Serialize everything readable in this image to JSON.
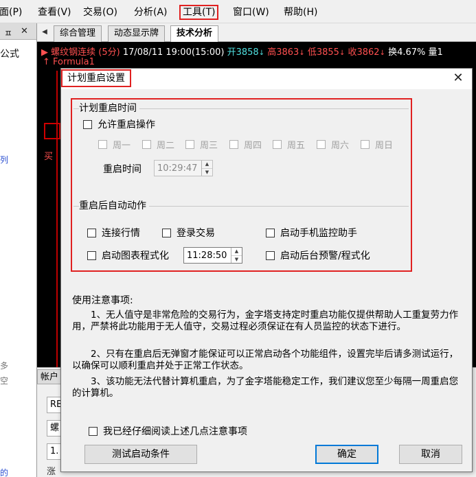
{
  "menubar": {
    "items": [
      "面(P)",
      "查看(V)",
      "交易(O)",
      "分析(A)",
      "工具(T)",
      "窗口(W)",
      "帮助(H)"
    ]
  },
  "left_panel": {
    "pin": "ㅍ",
    "close": "✕",
    "texts": [
      "公式",
      "列",
      "多",
      "空",
      "的"
    ]
  },
  "tabs": {
    "items": [
      "综合管理",
      "动态显示牌",
      "技术分析"
    ],
    "active": "技术分析"
  },
  "chart": {
    "symbol": "螺纹钢连续",
    "interval": "(5分)",
    "datetime": "17/08/11 19:00(15:00)",
    "open": "开3858",
    "high": "高3863",
    "low": "低3855",
    "close": "收3862",
    "turnover": "换4.67%",
    "volume_prefix": "量1",
    "formula": "Formula1",
    "buy_mark": "买",
    "colors": {
      "up": "#ff5050",
      "down": "#50e0e0",
      "bg": "#000000"
    }
  },
  "bottom_panel": {
    "tab": "帐户",
    "fields": [
      "RB",
      "螺",
      "1.",
      "涨"
    ]
  },
  "dialog": {
    "title": "计划重启设置",
    "close_icon": "close-icon",
    "restart_time_group": {
      "label": "计划重启时间",
      "allow": {
        "label": "允许重启操作",
        "checked": false
      },
      "days": [
        "周一",
        "周二",
        "周三",
        "周四",
        "周五",
        "周六",
        "周日"
      ],
      "time_label": "重启时间",
      "time_value": "10:29:47"
    },
    "auto_action_group": {
      "label": "重启后自动动作",
      "connect_quotes": "连接行情",
      "login_trade": "登录交易",
      "mobile_monitor": "启动手机监控助手",
      "chart_program": "启动图表程式化",
      "chart_program_time": "11:28:50",
      "background_alert": "启动后台预警/程式化"
    },
    "notes": {
      "heading": "使用注意事项:",
      "items": [
        "1、无人值守是非常危险的交易行为，金字塔支持定时重启功能仅提供帮助人工重复劳力作用，严禁将此功能用于无人值守，交易过程必须保证在有人员监控的状态下进行。",
        "2、只有在重启后无弹窗才能保证可以正常启动各个功能组件，设置完毕后请多测试运行，以确保可以顺利重启并处于正常工作状态。",
        "3、该功能无法代替计算机重启，为了金字塔能稳定工作，我们建议您至少每隔一周重启您的计算机。"
      ]
    },
    "acknowledge": {
      "label": "我已经仔细阅读上述几点注意事项",
      "checked": false
    },
    "buttons": {
      "test": "测试启动条件",
      "ok": "确定",
      "cancel": "取消"
    }
  }
}
